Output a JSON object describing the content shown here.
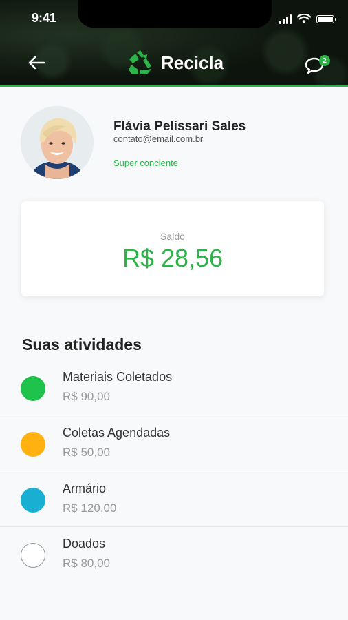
{
  "status_bar": {
    "time": "9:41"
  },
  "header": {
    "title": "Recicla",
    "messages_badge": "2",
    "accent_color": "#2db34a"
  },
  "profile": {
    "name": "Flávia Pelissari Sales",
    "email": "contato@email.com.br",
    "level": "Super conciente"
  },
  "balance": {
    "label": "Saldo",
    "value": "R$ 28,56"
  },
  "activities": {
    "title": "Suas atividades",
    "items": [
      {
        "label": "Materiais Coletados",
        "value": "R$ 90,00",
        "color": "#1fc24a"
      },
      {
        "label": "Coletas Agendadas",
        "value": "R$ 50,00",
        "color": "#ffb20f"
      },
      {
        "label": "Armário",
        "value": "R$ 120,00",
        "color": "#18afd3"
      },
      {
        "label": "Doados",
        "value": "R$ 80,00",
        "color": "#ffffff"
      }
    ]
  }
}
